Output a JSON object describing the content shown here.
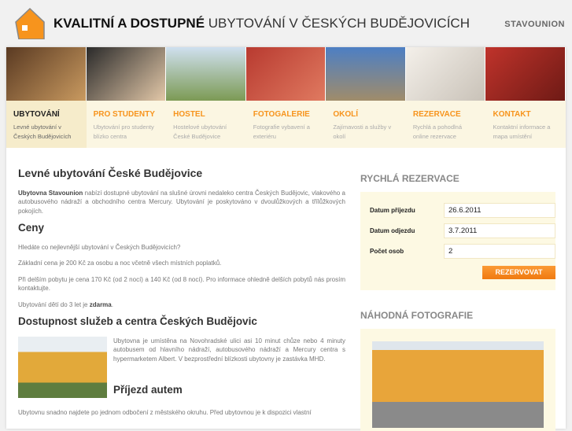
{
  "header": {
    "title_bold": "KVALITNÍ A DOSTUPNÉ",
    "title_rest": " UBYTOVÁNÍ V ČESKÝCH BUDĚJOVICÍCH",
    "brand": "STAVOUNION"
  },
  "banner_colors": [
    "#7b5230",
    "#8d7a5d",
    "#7c9a54",
    "#b83a30",
    "#5c7ea8",
    "#e9e4df",
    "#c0332b"
  ],
  "nav": [
    {
      "title": "UBYTOVÁNÍ",
      "sub": "Levné ubytování v Českých Budějovicích"
    },
    {
      "title": "PRO STUDENTY",
      "sub": "Ubytování pro studenty blízko centra"
    },
    {
      "title": "HOSTEL",
      "sub": "Hostelové ubytování České Budějovice"
    },
    {
      "title": "FOTOGALERIE",
      "sub": "Fotografie vybavení a exteriéru"
    },
    {
      "title": "OKOLÍ",
      "sub": "Zajímavosti a služby v okolí"
    },
    {
      "title": "REZERVACE",
      "sub": "Rychlá a pohodlná online rezervace"
    },
    {
      "title": "KONTAKT",
      "sub": "Kontaktní informace a mapa umístění"
    }
  ],
  "main": {
    "h1": "Levné ubytování České Budějovice",
    "intro_bold": "Ubytovna Stavounion",
    "intro": " nabízí dostupné ubytování na slušné úrovni nedaleko centra Českých Budějovic, vlakového a autobusového nádraží a obchodního centra Mercury. Ubytování je poskytováno v dvoulůžkových a třílůžkových pokojích.",
    "h2_prices": "Ceny",
    "p1": "Hledáte co nejlevnější ubytování v Českých Budějovicích?",
    "p2": "Základní cena je 200 Kč za osobu a noc včetně všech místních poplatků.",
    "p3": "Při delším pobytu je cena 170 Kč (od 2 nocí) a 140 Kč (od 8 nocí). Pro informace ohledně delších pobytů nás prosím kontaktujte.",
    "p4_a": "Ubytování dětí do 3 let je ",
    "p4_b": "zdarma",
    "p4_c": ".",
    "h2_access": "Dostupnost služeb a centra Českých Budějovic",
    "p5": "Ubytovna je umístěna na Novohradské ulici asi 10 minut chůze nebo 4 minuty autobusem od hlavního nádraží, autobusového nádraží a Mercury centra s hypermarketem Albert. V bezprostřední blízkosti ubytovny je zastávka MHD.",
    "h2_car": "Příjezd autem",
    "p6": "Ubytovnu snadno najdete po jednom odbočení z městského okruhu. Před ubytovnou je k dispozici vlastní"
  },
  "side": {
    "res_title": "RYCHLÁ REZERVACE",
    "arrival_label": "Datum příjezdu",
    "arrival": "26.6.2011",
    "departure_label": "Datum odjezdu",
    "departure": "3.7.2011",
    "persons_label": "Počet osob",
    "persons": "2",
    "submit": "REZERVOVAT",
    "photo_title": "NÁHODNÁ FOTOGRAFIE"
  }
}
